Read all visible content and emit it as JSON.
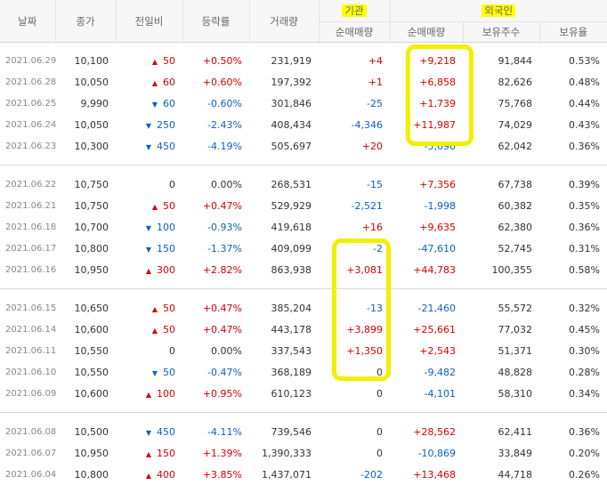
{
  "headers": {
    "date": "날짜",
    "close": "종가",
    "change": "전일비",
    "rate": "등락률",
    "volume": "거래량",
    "inst": "기관",
    "foreign": "외국인",
    "inst_net": "순매매량",
    "for_net": "순매매량",
    "for_hold": "보유주수",
    "for_ratio": "보유율"
  },
  "groups": [
    [
      {
        "date": "2021.06.29",
        "close": "10,100",
        "dir": "up",
        "chg": "50",
        "rate": "+0.50%",
        "vol": "231,919",
        "inst": "+4",
        "for": "+9,218",
        "hold": "91,844",
        "ratio": "0.53%"
      },
      {
        "date": "2021.06.28",
        "close": "10,050",
        "dir": "up",
        "chg": "60",
        "rate": "+0.60%",
        "vol": "197,392",
        "inst": "+1",
        "for": "+6,858",
        "hold": "82,626",
        "ratio": "0.48%"
      },
      {
        "date": "2021.06.25",
        "close": "9,990",
        "dir": "dn",
        "chg": "60",
        "rate": "-0.60%",
        "vol": "301,846",
        "inst": "-25",
        "for": "+1,739",
        "hold": "75,768",
        "ratio": "0.44%"
      },
      {
        "date": "2021.06.24",
        "close": "10,050",
        "dir": "dn",
        "chg": "250",
        "rate": "-2.43%",
        "vol": "408,434",
        "inst": "-4,346",
        "for": "+11,987",
        "hold": "74,029",
        "ratio": "0.43%"
      },
      {
        "date": "2021.06.23",
        "close": "10,300",
        "dir": "dn",
        "chg": "450",
        "rate": "-4.19%",
        "vol": "505,697",
        "inst": "+20",
        "for": "-5,696",
        "hold": "62,042",
        "ratio": "0.36%"
      }
    ],
    [
      {
        "date": "2021.06.22",
        "close": "10,750",
        "dir": "none",
        "chg": "0",
        "rate": "0.00%",
        "vol": "268,531",
        "inst": "-15",
        "for": "+7,356",
        "hold": "67,738",
        "ratio": "0.39%"
      },
      {
        "date": "2021.06.21",
        "close": "10,750",
        "dir": "up",
        "chg": "50",
        "rate": "+0.47%",
        "vol": "529,929",
        "inst": "-2,521",
        "for": "-1,998",
        "hold": "60,382",
        "ratio": "0.35%"
      },
      {
        "date": "2021.06.18",
        "close": "10,700",
        "dir": "dn",
        "chg": "100",
        "rate": "-0.93%",
        "vol": "419,618",
        "inst": "+16",
        "for": "+9,635",
        "hold": "62,380",
        "ratio": "0.36%"
      },
      {
        "date": "2021.06.17",
        "close": "10,800",
        "dir": "dn",
        "chg": "150",
        "rate": "-1.37%",
        "vol": "409,099",
        "inst": "-2",
        "for": "-47,610",
        "hold": "52,745",
        "ratio": "0.31%"
      },
      {
        "date": "2021.06.16",
        "close": "10,950",
        "dir": "up",
        "chg": "300",
        "rate": "+2.82%",
        "vol": "863,938",
        "inst": "+3,081",
        "for": "+44,783",
        "hold": "100,355",
        "ratio": "0.58%"
      }
    ],
    [
      {
        "date": "2021.06.15",
        "close": "10,650",
        "dir": "up",
        "chg": "50",
        "rate": "+0.47%",
        "vol": "385,204",
        "inst": "-13",
        "for": "-21,460",
        "hold": "55,572",
        "ratio": "0.32%"
      },
      {
        "date": "2021.06.14",
        "close": "10,600",
        "dir": "up",
        "chg": "50",
        "rate": "+0.47%",
        "vol": "443,178",
        "inst": "+3,899",
        "for": "+25,661",
        "hold": "77,032",
        "ratio": "0.45%"
      },
      {
        "date": "2021.06.11",
        "close": "10,550",
        "dir": "none",
        "chg": "0",
        "rate": "0.00%",
        "vol": "337,543",
        "inst": "+1,350",
        "for": "+2,543",
        "hold": "51,371",
        "ratio": "0.30%"
      },
      {
        "date": "2021.06.10",
        "close": "10,550",
        "dir": "dn",
        "chg": "50",
        "rate": "-0.47%",
        "vol": "368,189",
        "inst": "0",
        "for": "-9,482",
        "hold": "48,828",
        "ratio": "0.28%"
      },
      {
        "date": "2021.06.09",
        "close": "10,600",
        "dir": "up",
        "chg": "100",
        "rate": "+0.95%",
        "vol": "610,123",
        "inst": "0",
        "for": "-4,101",
        "hold": "58,310",
        "ratio": "0.34%"
      }
    ],
    [
      {
        "date": "2021.06.08",
        "close": "10,500",
        "dir": "dn",
        "chg": "450",
        "rate": "-4.11%",
        "vol": "739,546",
        "inst": "0",
        "for": "+28,562",
        "hold": "62,411",
        "ratio": "0.36%"
      },
      {
        "date": "2021.06.07",
        "close": "10,950",
        "dir": "up",
        "chg": "150",
        "rate": "+1.39%",
        "vol": "1,390,333",
        "inst": "0",
        "for": "-10,869",
        "hold": "33,849",
        "ratio": "0.20%"
      },
      {
        "date": "2021.06.04",
        "close": "10,800",
        "dir": "up",
        "chg": "400",
        "rate": "+3.85%",
        "vol": "1,437,071",
        "inst": "-202",
        "for": "+13,468",
        "hold": "44,718",
        "ratio": "0.26%"
      }
    ]
  ],
  "colors": {
    "up": "#d60000",
    "down": "#0e5fc9",
    "highlight": "#ffff00"
  }
}
